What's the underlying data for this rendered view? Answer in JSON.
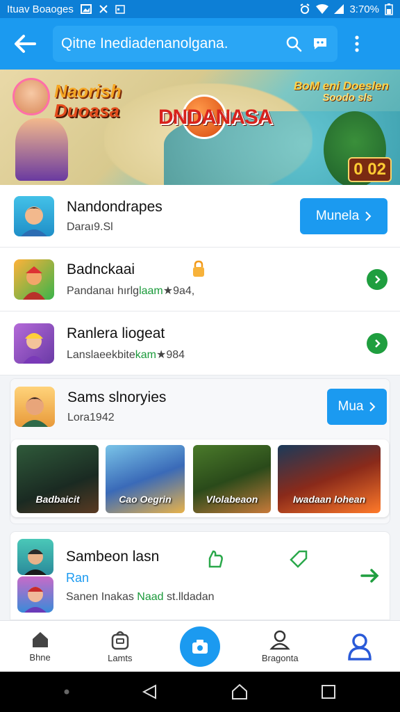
{
  "status_bar": {
    "left_text": "Ituav Boaoges",
    "time": "3:70%",
    "icon_names": [
      "gallery-icon",
      "notification-icon",
      "calendar-icon",
      "alarm-icon",
      "wifi-icon",
      "signal-icon",
      "battery-icon"
    ]
  },
  "appbar": {
    "search_query": "Qitne Inediadenanolgana.",
    "icon_names": [
      "back-arrow-icon",
      "search-icon",
      "chat-icon",
      "more-vertical-icon"
    ],
    "color": "#1b9af0"
  },
  "banner": {
    "left_title_1": "Naorish",
    "left_title_2": "Duoasa",
    "center_title": "DNDANASA",
    "right_line_1": "BoM eni Doeslen",
    "right_line_2": "Soodo sls",
    "badge": "0 02"
  },
  "rows": [
    {
      "title": "Nandondrapes",
      "subtitle": "Daraı9.Sl",
      "button": "Munela",
      "icon": "avatar-icon"
    },
    {
      "title": "Badnckaai",
      "subtitle_before": "Pandanaı hırlg",
      "subtitle_highlight": "laam",
      "subtitle_after": "★9a4,",
      "icon": "game-icon",
      "badge_icon": "lock-icon"
    },
    {
      "title": "Ranlera liogeat",
      "subtitle_before": "Lanslaeekbite",
      "subtitle_highlight": "kam",
      "subtitle_after": "★984",
      "icon": "game-icon"
    },
    {
      "title": "Sams slnoryies",
      "subtitle": "Lora1942",
      "button": "Mua",
      "icon": "avatar-icon"
    },
    {
      "title": "Sambeon lasn",
      "subtitle": "Ran",
      "subtitle_2_before": "Sanen Inakas ",
      "subtitle_2_highlight": "Naad",
      "subtitle_2_after": " st.lldadan",
      "icon": "avatar-icon"
    }
  ],
  "games": [
    {
      "label": "Badbaicit"
    },
    {
      "label": "Cao Oegrin"
    },
    {
      "label": "Vlolabeaon"
    },
    {
      "label": "Iwadaan lohean"
    }
  ],
  "bottom_nav": [
    {
      "label": "Bhne",
      "icon": "home-icon"
    },
    {
      "label": "Lamts",
      "icon": "bag-icon"
    },
    {
      "label": "",
      "icon": "camera-icon"
    },
    {
      "label": "Bragonta",
      "icon": "person-icon"
    },
    {
      "label": "",
      "icon": "profile-icon"
    }
  ]
}
